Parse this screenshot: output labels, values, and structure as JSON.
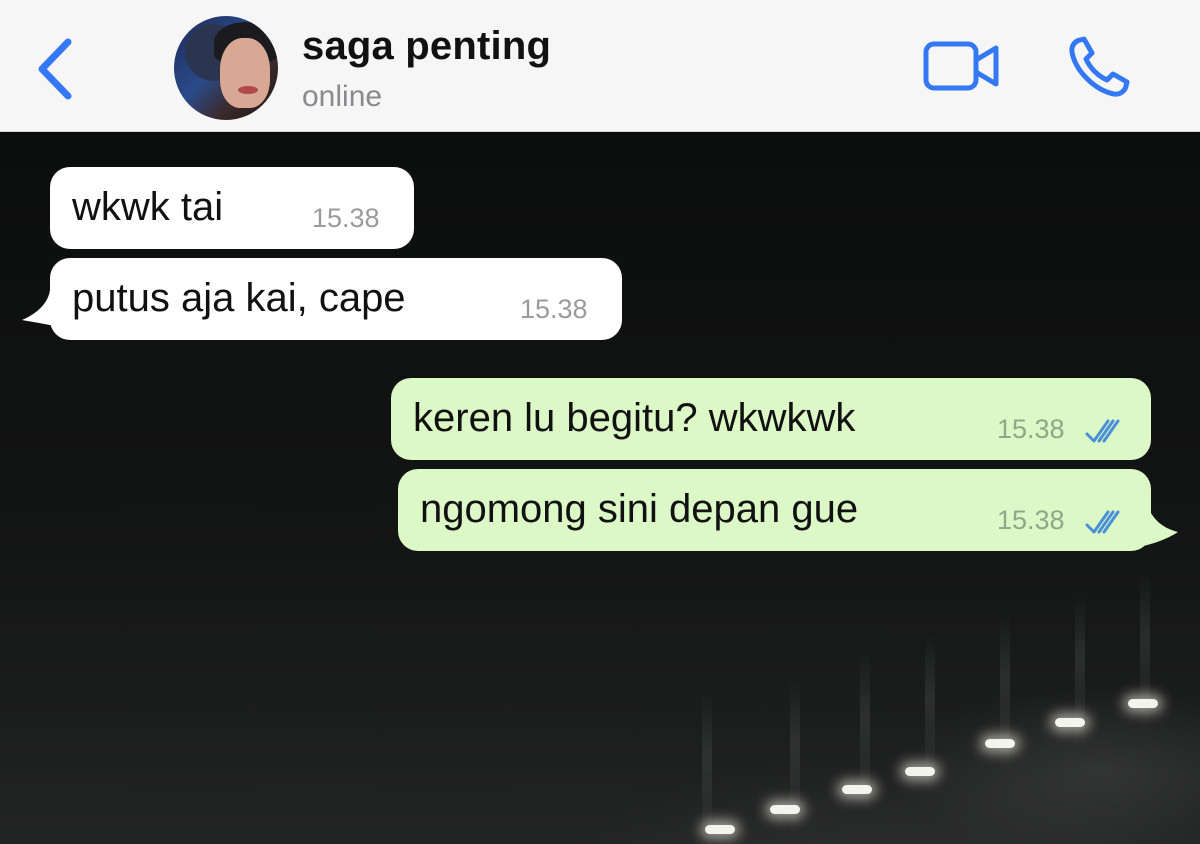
{
  "header": {
    "contact_name": "saga penting",
    "status": "online"
  },
  "colors": {
    "accent": "#3478f6",
    "incoming_bubble": "#ffffff",
    "outgoing_bubble": "#dcf8c6",
    "read_ticks": "#4a90d9"
  },
  "icons": {
    "back": "chevron-left-icon",
    "video": "video-camera-icon",
    "call": "phone-icon",
    "read_receipt": "double-check-icon"
  },
  "messages": [
    {
      "direction": "in",
      "text": "wkwk tai",
      "time": "15.38"
    },
    {
      "direction": "in",
      "text": "putus aja kai, cape",
      "time": "15.38"
    },
    {
      "direction": "out",
      "text": "keren lu begitu? wkwkwk",
      "time": "15.38",
      "read": true
    },
    {
      "direction": "out",
      "text": "ngomong sini depan gue",
      "time": "15.38",
      "read": true
    }
  ]
}
